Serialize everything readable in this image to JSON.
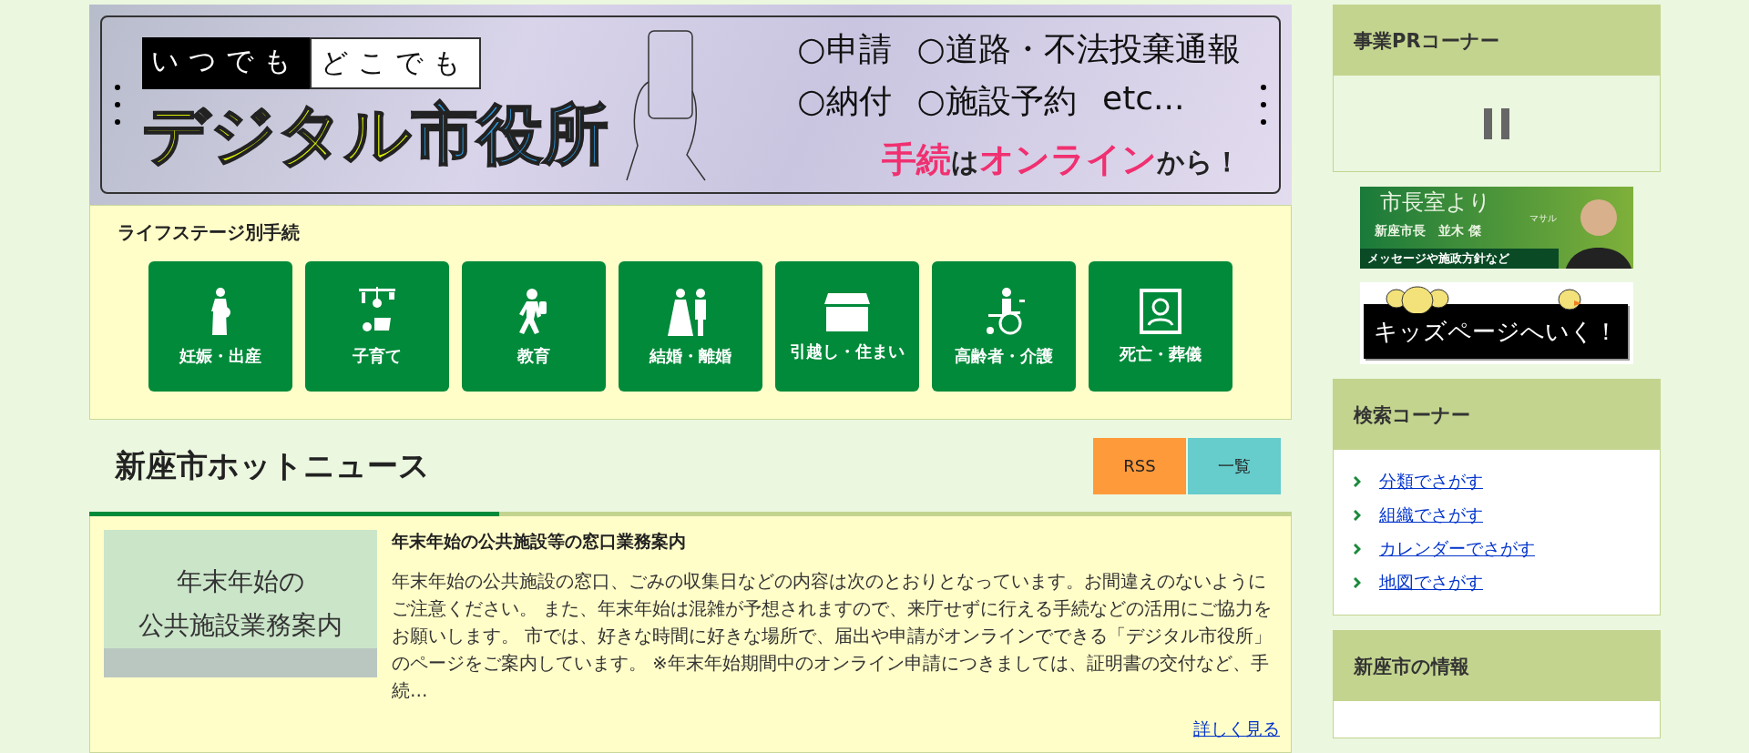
{
  "banner": {
    "tagline": [
      {
        "text": "いつでも",
        "kind": "inverse"
      },
      {
        "text": "どこでも",
        "kind": "outline"
      }
    ],
    "title": [
      {
        "text": "デジタル",
        "kind": "yellow"
      },
      {
        "text": "市役所",
        "kind": "blue"
      }
    ],
    "services": [
      {
        "items": [
          "○申請",
          "○道路・不法投棄通報"
        ]
      },
      {
        "items": [
          "○納付",
          "○施設予約",
          "etc..."
        ]
      }
    ],
    "cta": [
      {
        "text": "手続",
        "kind": "accent"
      },
      {
        "text": "は",
        "kind": "plain"
      },
      {
        "text": "オンライン",
        "kind": "accent"
      },
      {
        "text": "から！",
        "kind": "plain"
      }
    ]
  },
  "life_stage": {
    "title": "ライフステージ別手続",
    "items": [
      {
        "label": "妊娠・出産",
        "kind": "pregnancy"
      },
      {
        "label": "子育て",
        "kind": "childcare"
      },
      {
        "label": "教育",
        "kind": "education"
      },
      {
        "label": "結婚・離婚",
        "kind": "marriage"
      },
      {
        "label": "引越し・住まい",
        "kind": "moving"
      },
      {
        "label": "高齢者・介護",
        "kind": "elderly"
      },
      {
        "label": "死亡・葬儀",
        "kind": "funeral"
      }
    ]
  },
  "news": {
    "title": "新座市ホットニュース",
    "buttons": [
      {
        "label": "RSS",
        "kind": "rss"
      },
      {
        "label": "一覧",
        "kind": "list"
      }
    ],
    "items": [
      {
        "image_lines": [
          "年末年始の",
          "公共施設業務案内"
        ],
        "title": "年末年始の公共施設等の窓口業務案内",
        "summary": "年末年始の公共施設の窓口、ごみの収集日などの内容は次のとおりとなっています。お間違えのないようにご注意ください。 また、年末年始は混雑が予想されますので、来庁せずに行える手続などの活用にご協力をお願いします。 市では、好きな時間に好きな場所で、届出や申請がオンラインでできる「デジタル市役所」のページをご案内しています。 ※年末年始期間中のオンライン申請につきましては、証明書の交付など、手続…",
        "more": "詳しく見る"
      }
    ]
  },
  "sidebar": {
    "pr": {
      "title": "事業PRコーナー"
    },
    "banners": [
      {
        "kind": "mayor",
        "title": "市長室より",
        "ruby": "マサル",
        "name": "新座市長　並木 傑",
        "caption": "メッセージや施政方針など"
      },
      {
        "kind": "kids",
        "title": "キッズページへいく！"
      }
    ],
    "search": {
      "title": "検索コーナー",
      "links": [
        "分類でさがす",
        "組織でさがす",
        "カレンダーでさがす",
        "地図でさがす"
      ]
    },
    "info": {
      "title": "新座市の情報"
    }
  }
}
